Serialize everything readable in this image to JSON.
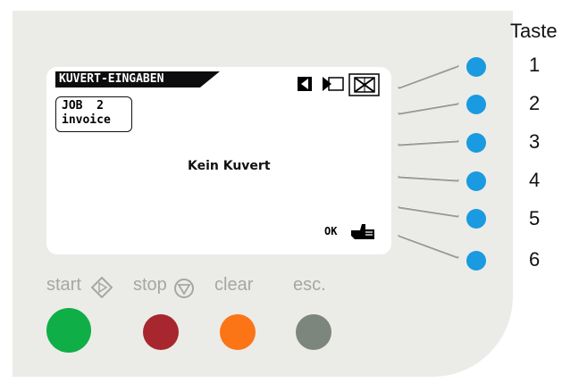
{
  "panel": {
    "taste_label": "Taste",
    "softkeys": [
      "1",
      "2",
      "3",
      "4",
      "5",
      "6"
    ]
  },
  "lcd": {
    "title": "KUVERT-EINGABEN",
    "job_line1": "JOB  2",
    "job_line2": "invoice",
    "message": "Kein Kuvert",
    "ok_label": "OK"
  },
  "controls": {
    "start_label": "start",
    "stop_label": "stop",
    "clear_label": "clear",
    "esc_label": "esc."
  },
  "colors": {
    "start": "#0fae47",
    "stop": "#a8262d",
    "clear": "#fb7416",
    "esc": "#7d867c",
    "softkey": "#1a9ae0"
  }
}
